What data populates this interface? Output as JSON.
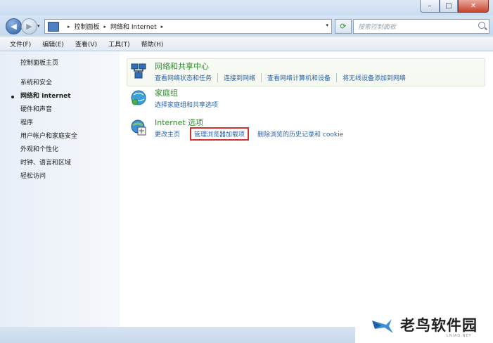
{
  "window": {
    "controls": {
      "minimize": "–",
      "maximize": "□",
      "close": "✕"
    }
  },
  "nav": {
    "back_icon": "back-arrow-icon",
    "forward_icon": "forward-arrow-icon",
    "back_glyph": "◀",
    "forward_glyph": "▶",
    "history_glyph": "▾",
    "breadcrumb": [
      "控制面板",
      "网络和 Internet"
    ],
    "separator_glyph": "▸",
    "address_dropdown_glyph": "▾",
    "refresh_glyph": "⟳",
    "search_placeholder": "搜索控制面板"
  },
  "menu": {
    "items": [
      "文件(F)",
      "编辑(E)",
      "查看(V)",
      "工具(T)",
      "帮助(H)"
    ]
  },
  "sidebar": {
    "home": "控制面板主页",
    "items": [
      {
        "label": "系统和安全",
        "active": false
      },
      {
        "label": "网络和 Internet",
        "active": true
      },
      {
        "label": "硬件和声音",
        "active": false
      },
      {
        "label": "程序",
        "active": false
      },
      {
        "label": "用户帐户和家庭安全",
        "active": false
      },
      {
        "label": "外观和个性化",
        "active": false
      },
      {
        "label": "时钟、语言和区域",
        "active": false
      },
      {
        "label": "轻松访问",
        "active": false
      }
    ]
  },
  "categories": [
    {
      "title": "网络和共享中心",
      "icon": "network-sharing-icon",
      "links": [
        "查看网络状态和任务",
        "连接到网络",
        "查看网络计算机和设备",
        "将无线设备添加到网络"
      ]
    },
    {
      "title": "家庭组",
      "icon": "homegroup-icon",
      "links": [
        "选择家庭组和共享选项"
      ]
    },
    {
      "title": "Internet 选项",
      "icon": "internet-options-icon",
      "links": [
        "更改主页",
        "管理浏览器加载项",
        "删除浏览的历史记录和 cookie"
      ],
      "highlighted_link": "管理浏览器加载项"
    }
  ],
  "watermark": {
    "text": "老鸟软件园",
    "subtext": "LNIAO.NET"
  },
  "colors": {
    "category_title": "#2d8a2d",
    "link": "#2962a8",
    "highlight_box": "#d03030"
  }
}
